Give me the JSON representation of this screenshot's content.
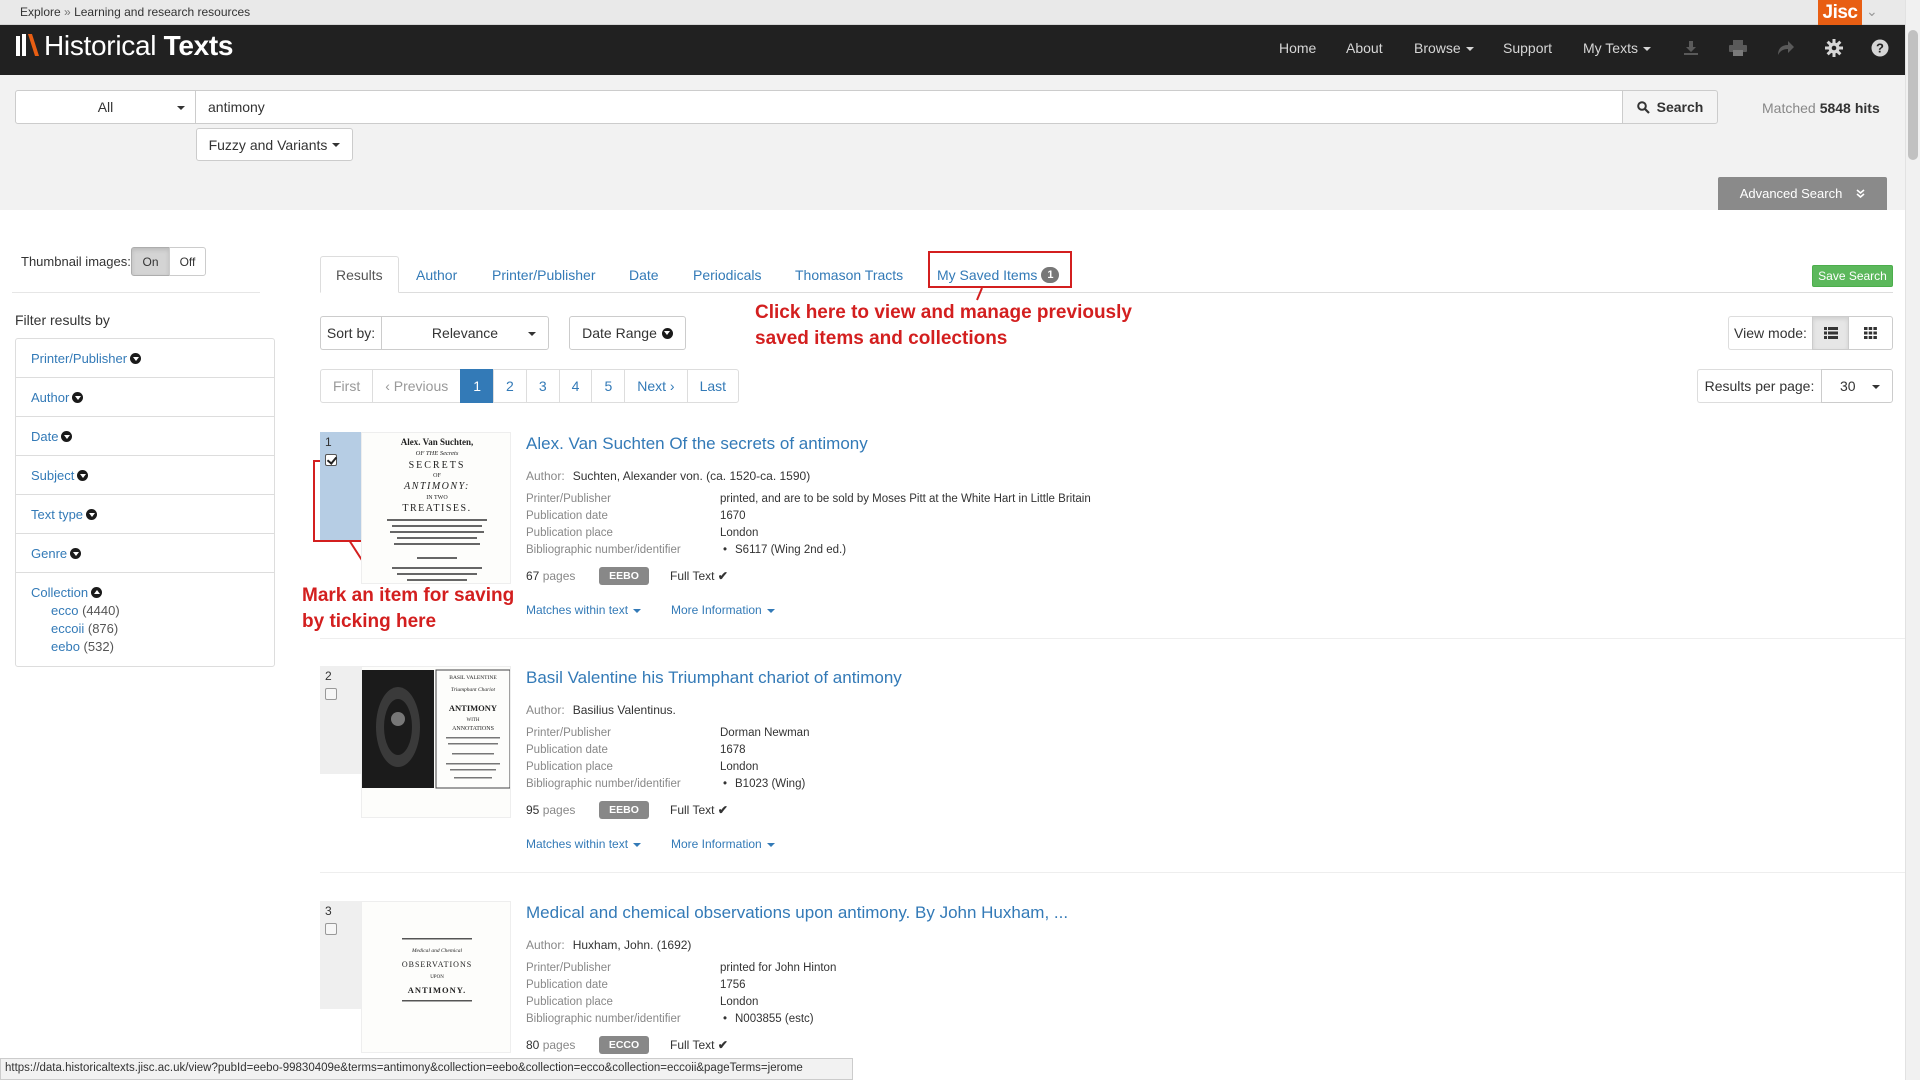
{
  "breadcrumb": {
    "root": "Explore",
    "sep": "»",
    "current": "Learning and research resources"
  },
  "jisc": {
    "label": "Jisc"
  },
  "logo": {
    "light": "Historical ",
    "bold": "Texts"
  },
  "nav": {
    "home": "Home",
    "about": "About",
    "browse": "Browse",
    "support": "Support",
    "my_texts": "My Texts"
  },
  "search": {
    "scope": "All",
    "query": "antimony",
    "button": "Search",
    "matched_label": "Matched",
    "matched_count": "5848",
    "matched_unit": "hits",
    "fuzzy": "Fuzzy and Variants",
    "advanced": "Advanced Search"
  },
  "thumbnails": {
    "label": "Thumbnail images:",
    "on": "On",
    "off": "Off"
  },
  "filters": {
    "title": "Filter results by",
    "items": [
      "Printer/Publisher",
      "Author",
      "Date",
      "Subject",
      "Text type",
      "Genre"
    ],
    "collection": {
      "label": "Collection",
      "subs": [
        {
          "name": "ecco",
          "count": "(4440)"
        },
        {
          "name": "eccoii",
          "count": "(876)"
        },
        {
          "name": "eebo",
          "count": "(532)"
        }
      ]
    }
  },
  "tabs": [
    "Results",
    "Author",
    "Printer/Publisher",
    "Date",
    "Periodicals",
    "Thomason Tracts"
  ],
  "saved_tab": {
    "label": "My Saved Items",
    "count": "1"
  },
  "save_search": "Save Search",
  "annotations": {
    "saved": [
      "Click here to view and manage previously",
      "saved items and collections"
    ],
    "tick": [
      "Mark an item for saving",
      "by ticking here"
    ]
  },
  "sort": {
    "label": "Sort by:",
    "value": "Relevance",
    "date_range": "Date Range"
  },
  "view_mode": {
    "label": "View mode:"
  },
  "pagination": [
    "First",
    "‹ Previous",
    "1",
    "2",
    "3",
    "4",
    "5",
    "Next ›",
    "Last"
  ],
  "rpp": {
    "label": "Results per page:",
    "value": "30"
  },
  "meta_labels": {
    "author": "Author:",
    "publisher": "Printer/Publisher",
    "date": "Publication date",
    "place": "Publication place",
    "biblio": "Bibliographic number/identifier",
    "pages": "pages",
    "fulltext": "Full Text",
    "matches": "Matches within text",
    "more": "More Information"
  },
  "results": [
    {
      "num": "1",
      "checked": true,
      "title": "Alex. Van Suchten Of the secrets of antimony",
      "author": "Suchten, Alexander von. (ca. 1520-ca. 1590)",
      "publisher": "printed, and are to be sold by Moses Pitt at the White Hart in Little Britain",
      "date": "1670",
      "place": "London",
      "biblio": "S6117 (Wing 2nd ed.)",
      "pages": "67",
      "collection": "EEBO",
      "thumb_lines": [
        "Alex. Van Suchten,",
        "OF THE Secrets",
        "SECRETS",
        "OF",
        "ANTIMONY:",
        "IN TWO",
        "TREATISES."
      ]
    },
    {
      "num": "2",
      "checked": false,
      "title": "Basil Valentine his Triumphant chariot of antimony",
      "author": "Basilius Valentinus.",
      "publisher": "Dorman Newman",
      "date": "1678",
      "place": "London",
      "biblio": "B1023 (Wing)",
      "pages": "95",
      "collection": "EEBO",
      "thumb_lines": [
        "BASIL VALENTINE",
        "Triumphant Chariot",
        "ANTIMONY",
        "WITH",
        "ANNOTATIONS"
      ]
    },
    {
      "num": "3",
      "checked": false,
      "title": "Medical and chemical observations upon antimony. By John Huxham, ...",
      "author": "Huxham, John. (1692)",
      "publisher": "printed for John Hinton",
      "date": "1756",
      "place": "London",
      "biblio": "N003855 (estc)",
      "pages": "80",
      "collection": "ECCO",
      "thumb_lines": [
        "Medical and Chemical",
        "OBSERVATIONS",
        "UPON",
        "ANTIMONY."
      ]
    }
  ],
  "status_url": "https://data.historicaltexts.jisc.ac.uk/view?pubId=eebo-99830409e&terms=antimony&collection=eebo&collection=ecco&collection=eccoii&pageTerms=jerome",
  "colors": {
    "accent": "#337ab7",
    "navbar": "#212121",
    "annotation": "#d31f1f",
    "jisc": "#e85e13",
    "save": "#5cb85c"
  }
}
